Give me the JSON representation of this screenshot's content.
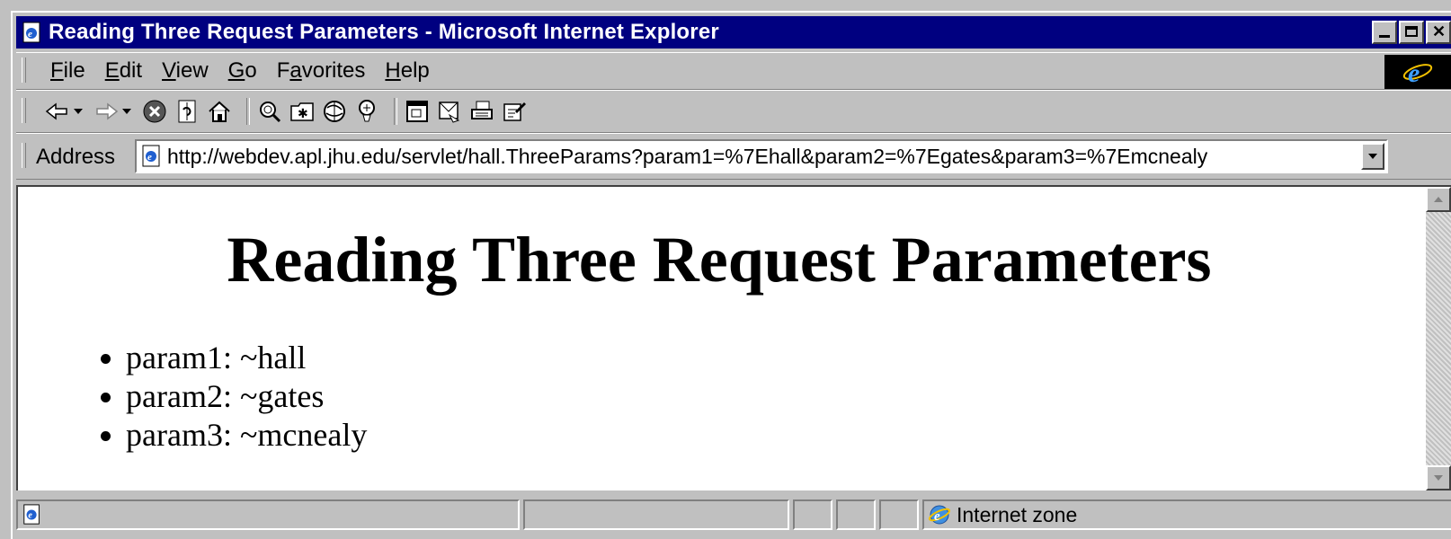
{
  "window": {
    "title": "Reading Three Request Parameters - Microsoft Internet Explorer"
  },
  "menu": {
    "items": [
      {
        "key": "F",
        "rest": "ile"
      },
      {
        "key": "E",
        "rest": "dit"
      },
      {
        "key": "V",
        "rest": "iew"
      },
      {
        "key": "G",
        "rest": "o"
      },
      {
        "pre": "F",
        "key": "a",
        "rest": "vorites"
      },
      {
        "key": "H",
        "rest": "elp"
      }
    ]
  },
  "address": {
    "label": "Address",
    "url": "http://webdev.apl.jhu.edu/servlet/hall.ThreeParams?param1=%7Ehall&param2=%7Egates&param3=%7Emcnealy"
  },
  "page": {
    "heading": "Reading Three Request Parameters",
    "params": [
      "param1: ~hall",
      "param2: ~gates",
      "param3: ~mcnealy"
    ]
  },
  "status": {
    "zone": "Internet zone"
  },
  "icons": [
    "ie-page-icon",
    "back-icon",
    "forward-icon",
    "stop-icon",
    "refresh-icon",
    "home-icon",
    "search-icon",
    "favorites-icon",
    "history-icon",
    "channels-icon",
    "fullscreen-icon",
    "mail-icon",
    "print-icon",
    "edit-icon",
    "ie-logo-icon",
    "globe-icon"
  ],
  "colors": {
    "titlebar": "#000080",
    "chrome": "#c0c0c0"
  }
}
